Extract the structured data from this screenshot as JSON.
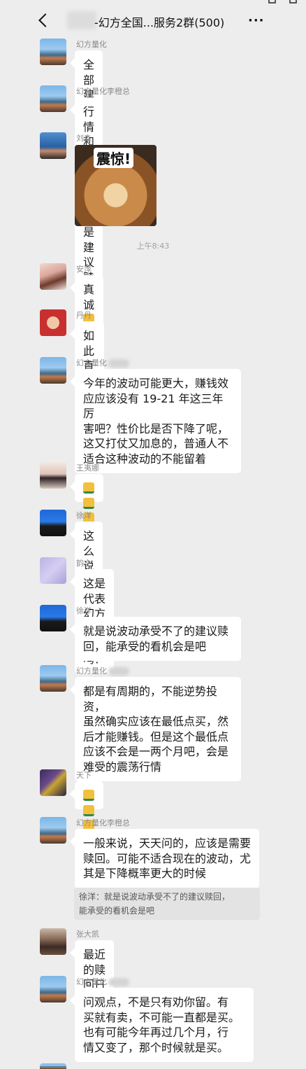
{
  "header": {
    "title": "-幻方全国...服务2群(500)",
    "more": "···"
  },
  "messages": [
    {
      "sender": "幻方量化",
      "text": "全部建议赎回"
    },
    {
      "sender": "幻方量化李橙总",
      "text": "行情和策略观点都是建议赎回"
    },
    {
      "sender": "刘淼",
      "sticker_text": "震惊!"
    },
    {
      "time": "上午8:43"
    },
    {
      "sender": "安萍",
      "text": "真诚"
    },
    {
      "sender": "丹丹",
      "text": "如此直白"
    },
    {
      "sender": "幻方量化",
      "lines": [
        "今年的波动可能更大，赚钱效",
        "应应该没有 19-21 年这三年厉",
        "害吧？性价比是否下降了呢，",
        "这又打仗又加息的，普通人不",
        "适合这种波动的不能留着"
      ]
    },
    {
      "sender": "王夷娜",
      "text": ""
    },
    {
      "sender": "徐洋",
      "text": "这么说理解了"
    },
    {
      "sender": "韵之",
      "text": "这是代表幻方的观点吗？"
    },
    {
      "sender": "徐洋",
      "lines": [
        "就是说波动承受不了的建议赎",
        "回，能承受的看机会是吧"
      ]
    },
    {
      "sender": "幻方量化",
      "lines": [
        "都是有周期的，不能逆势投资，",
        "虽然确实应该在最低点买，然",
        "后才能赚钱。但是这个最低点",
        "应该不会是一两个月吧，会是",
        "难受的震荡行情"
      ]
    },
    {
      "sender": "天下",
      "text": ""
    },
    {
      "sender": "幻方量化李橙总",
      "lines": [
        "一般来说，天天问的，应该是需要",
        "赎回。可能不适合现在的波动，尤",
        "其是下降概率更大的时候"
      ],
      "quote_lines": [
        "徐洋：就是说波动承受不了的建议赎回，",
        "能承受的看机会是吧"
      ]
    },
    {
      "sender": "张大凯",
      "text": "最近的赎回日是什么时候？"
    },
    {
      "sender": "幻方量化",
      "lines": [
        "问观点，不是只有劝你留。有",
        "买就有卖，不可能一直都是买。",
        "也有可能今年再过几个月，行",
        "情又变了，那个时候就是买。"
      ]
    }
  ]
}
